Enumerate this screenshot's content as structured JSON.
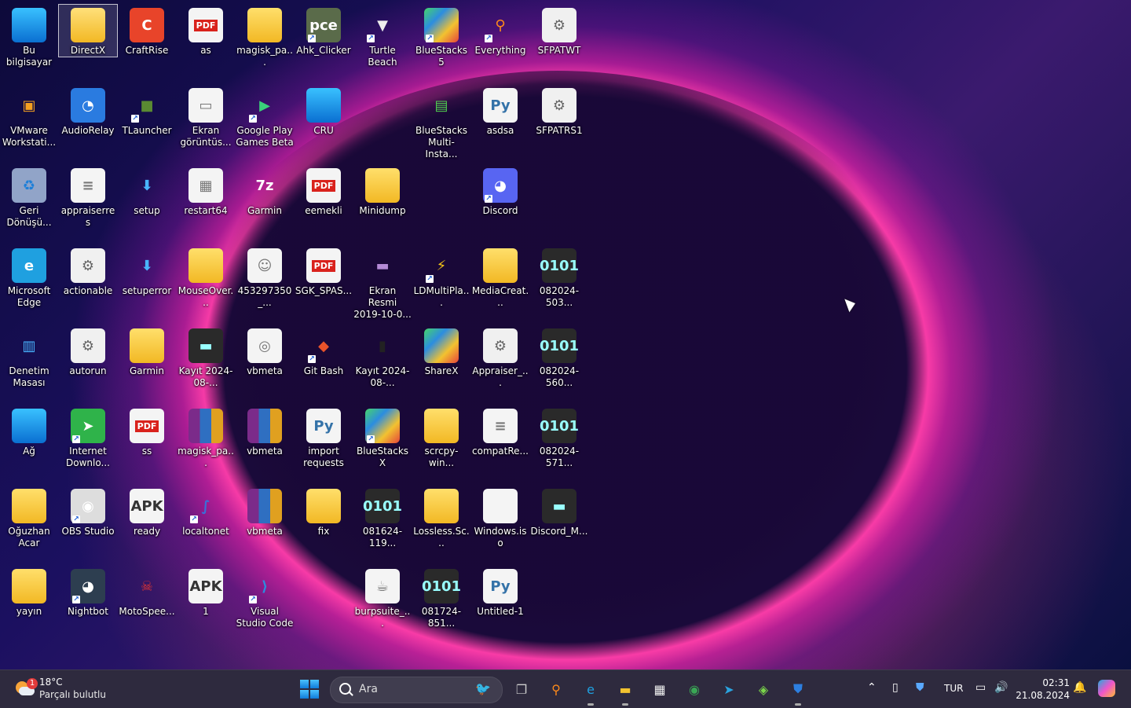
{
  "desktop_icons": [
    {
      "label": "Bu bilgisayar",
      "col": 0,
      "row": 0,
      "style": "k-monitor",
      "glyph": "",
      "shortcut": false,
      "selected": false
    },
    {
      "label": "DirectX",
      "col": 1,
      "row": 0,
      "style": "k-folder-red",
      "glyph": "",
      "shortcut": false,
      "selected": true
    },
    {
      "label": "CraftRise",
      "col": 2,
      "row": 0,
      "style": "k-round",
      "glyph": "C",
      "color": "#e8442a",
      "shortcut": false,
      "selected": false
    },
    {
      "label": "as",
      "col": 3,
      "row": 0,
      "style": "k-pdf",
      "glyph": "PDF",
      "shortcut": false,
      "selected": false
    },
    {
      "label": "magisk_pa...",
      "col": 4,
      "row": 0,
      "style": "k-folder",
      "glyph": "",
      "shortcut": false,
      "selected": false
    },
    {
      "label": "Ahk_Clicker",
      "col": 5,
      "row": 0,
      "style": "k-round",
      "glyph": "pce",
      "color": "#5a6b4a",
      "shortcut": true,
      "selected": false
    },
    {
      "label": "Turtle Beach",
      "col": 6,
      "row": 0,
      "style": "",
      "glyph": "▼",
      "color": "#eee",
      "shortcut": true,
      "selected": false
    },
    {
      "label": "BlueStacks 5",
      "col": 7,
      "row": 0,
      "style": "k-bluegreen",
      "glyph": "",
      "shortcut": true,
      "selected": false
    },
    {
      "label": "Everything",
      "col": 8,
      "row": 0,
      "style": "",
      "glyph": "⚲",
      "color": "#ff8a1a",
      "shortcut": true,
      "selected": false
    },
    {
      "label": "SFPATWT",
      "col": 9,
      "row": 0,
      "style": "k-gear",
      "glyph": "⚙",
      "shortcut": false,
      "selected": false
    },
    {
      "label": "VMware Workstati...",
      "col": 0,
      "row": 1,
      "style": "",
      "glyph": "▣",
      "color": "#f4a020",
      "shortcut": false,
      "selected": false
    },
    {
      "label": "AudioRelay",
      "col": 1,
      "row": 1,
      "style": "k-round",
      "glyph": "◔",
      "color": "#2a7be0",
      "shortcut": false,
      "selected": false
    },
    {
      "label": "TLauncher",
      "col": 2,
      "row": 1,
      "style": "",
      "glyph": "■",
      "color": "#5a8a32",
      "shortcut": true,
      "selected": false
    },
    {
      "label": "Ekran görüntüs...",
      "col": 3,
      "row": 1,
      "style": "k-file",
      "glyph": "▭",
      "shortcut": false,
      "selected": false
    },
    {
      "label": "Google Play Games Beta",
      "col": 4,
      "row": 1,
      "style": "",
      "glyph": "▶",
      "color": "#3ad07a",
      "shortcut": true,
      "selected": false
    },
    {
      "label": "CRU",
      "col": 5,
      "row": 1,
      "style": "k-monitor",
      "glyph": "",
      "shortcut": false,
      "selected": false
    },
    {
      "label": "BlueStacks Multi-Insta...",
      "col": 7,
      "row": 1,
      "style": "",
      "glyph": "▤",
      "color": "#4fd14f",
      "shortcut": false,
      "selected": false
    },
    {
      "label": "asdsa",
      "col": 8,
      "row": 1,
      "style": "k-py",
      "glyph": "Py",
      "shortcut": false,
      "selected": false
    },
    {
      "label": "SFPATRS1",
      "col": 9,
      "row": 1,
      "style": "k-gear",
      "glyph": "⚙",
      "shortcut": false,
      "selected": false
    },
    {
      "label": "Geri Dönüşü...",
      "col": 0,
      "row": 2,
      "style": "k-bin",
      "glyph": "♻",
      "shortcut": false,
      "selected": false
    },
    {
      "label": "appraiserres",
      "col": 1,
      "row": 2,
      "style": "k-file",
      "glyph": "≡",
      "shortcut": false,
      "selected": false
    },
    {
      "label": "setup",
      "col": 2,
      "row": 2,
      "style": "",
      "glyph": "⬇",
      "color": "#49b5ff",
      "shortcut": false,
      "selected": false
    },
    {
      "label": "restart64",
      "col": 3,
      "row": 2,
      "style": "k-file",
      "glyph": "▦",
      "shortcut": false,
      "selected": false
    },
    {
      "label": "Garmin",
      "col": 4,
      "row": 2,
      "style": "",
      "glyph": "7z",
      "color": "#fff",
      "shortcut": false,
      "selected": false
    },
    {
      "label": "eemekli",
      "col": 5,
      "row": 2,
      "style": "k-pdf",
      "glyph": "PDF",
      "shortcut": false,
      "selected": false
    },
    {
      "label": "Minidump",
      "col": 6,
      "row": 2,
      "style": "k-folder",
      "glyph": "",
      "shortcut": false,
      "selected": false
    },
    {
      "label": "Discord",
      "col": 8,
      "row": 2,
      "style": "k-round",
      "glyph": "◕",
      "color": "#5865f2",
      "shortcut": true,
      "selected": false
    },
    {
      "label": "Microsoft Edge",
      "col": 0,
      "row": 3,
      "style": "k-round",
      "glyph": "e",
      "color": "#1fa0e0",
      "shortcut": false,
      "selected": false
    },
    {
      "label": "actionable",
      "col": 1,
      "row": 3,
      "style": "k-gear",
      "glyph": "⚙",
      "shortcut": false,
      "selected": false
    },
    {
      "label": "setuperror",
      "col": 2,
      "row": 3,
      "style": "",
      "glyph": "⬇",
      "color": "#49b5ff",
      "shortcut": false,
      "selected": false
    },
    {
      "label": "MouseOver...",
      "col": 3,
      "row": 3,
      "style": "k-folder",
      "glyph": "",
      "shortcut": false,
      "selected": false
    },
    {
      "label": "453297350_...",
      "col": 4,
      "row": 3,
      "style": "k-file",
      "glyph": "☺",
      "shortcut": false,
      "selected": false
    },
    {
      "label": "SGK_SPAS...",
      "col": 5,
      "row": 3,
      "style": "k-pdf",
      "glyph": "PDF",
      "shortcut": false,
      "selected": false
    },
    {
      "label": "Ekran Resmi 2019-10-0...",
      "col": 6,
      "row": 3,
      "style": "",
      "glyph": "▬",
      "color": "#b48ad6",
      "shortcut": false,
      "selected": false
    },
    {
      "label": "LDMultiPla...",
      "col": 7,
      "row": 3,
      "style": "",
      "glyph": "⚡",
      "color": "#f5c518",
      "shortcut": true,
      "selected": false
    },
    {
      "label": "MediaCreat...",
      "col": 8,
      "row": 3,
      "style": "k-folder",
      "glyph": "",
      "shortcut": false,
      "selected": false
    },
    {
      "label": "082024-503...",
      "col": 9,
      "row": 3,
      "style": "k-dark",
      "glyph": "0101",
      "shortcut": false,
      "selected": false
    },
    {
      "label": "Denetim Masası",
      "col": 0,
      "row": 4,
      "style": "",
      "glyph": "▥",
      "color": "#49b5ff",
      "shortcut": false,
      "selected": false
    },
    {
      "label": "autorun",
      "col": 1,
      "row": 4,
      "style": "k-gear",
      "glyph": "⚙",
      "shortcut": false,
      "selected": false
    },
    {
      "label": "Garmin",
      "col": 2,
      "row": 4,
      "style": "k-folder",
      "glyph": "",
      "shortcut": false,
      "selected": false
    },
    {
      "label": "Kayıt 2024-08-...",
      "col": 3,
      "row": 4,
      "style": "k-dark",
      "glyph": "▬",
      "shortcut": false,
      "selected": false
    },
    {
      "label": "vbmeta",
      "col": 4,
      "row": 4,
      "style": "k-file",
      "glyph": "◎",
      "shortcut": false,
      "selected": false
    },
    {
      "label": "Git Bash",
      "col": 5,
      "row": 4,
      "style": "",
      "glyph": "◆",
      "color": "#e8532a",
      "shortcut": true,
      "selected": false
    },
    {
      "label": "Kayıt 2024-08-...",
      "col": 6,
      "row": 4,
      "style": "",
      "glyph": "▮",
      "color": "#222",
      "shortcut": false,
      "selected": false
    },
    {
      "label": "ShareX",
      "col": 7,
      "row": 4,
      "style": "k-round k-bluegreen",
      "glyph": "",
      "shortcut": false,
      "selected": false
    },
    {
      "label": "Appraiser_...",
      "col": 8,
      "row": 4,
      "style": "k-gear",
      "glyph": "⚙",
      "shortcut": false,
      "selected": false
    },
    {
      "label": "082024-560...",
      "col": 9,
      "row": 4,
      "style": "k-dark",
      "glyph": "0101",
      "shortcut": false,
      "selected": false
    },
    {
      "label": "Ağ",
      "col": 0,
      "row": 5,
      "style": "k-monitor",
      "glyph": "",
      "shortcut": false,
      "selected": false
    },
    {
      "label": "Internet Downlo...",
      "col": 1,
      "row": 5,
      "style": "k-round",
      "glyph": "➤",
      "color": "#2fb34a",
      "shortcut": true,
      "selected": false
    },
    {
      "label": "ss",
      "col": 2,
      "row": 5,
      "style": "k-pdf",
      "glyph": "PDF",
      "shortcut": false,
      "selected": false
    },
    {
      "label": "magisk_pa...",
      "col": 3,
      "row": 5,
      "style": "k-rar",
      "glyph": "",
      "shortcut": false,
      "selected": false
    },
    {
      "label": "vbmeta",
      "col": 4,
      "row": 5,
      "style": "k-rar",
      "glyph": "",
      "shortcut": false,
      "selected": false
    },
    {
      "label": "import requests",
      "col": 5,
      "row": 5,
      "style": "k-py",
      "glyph": "Py",
      "shortcut": false,
      "selected": false
    },
    {
      "label": "BlueStacks X",
      "col": 6,
      "row": 5,
      "style": "k-bluegreen",
      "glyph": "",
      "shortcut": true,
      "selected": false
    },
    {
      "label": "scrcpy-win...",
      "col": 7,
      "row": 5,
      "style": "k-folder",
      "glyph": "",
      "shortcut": false,
      "selected": false
    },
    {
      "label": "compatRe...",
      "col": 8,
      "row": 5,
      "style": "k-file",
      "glyph": "≡",
      "shortcut": false,
      "selected": false
    },
    {
      "label": "082024-571...",
      "col": 9,
      "row": 5,
      "style": "k-dark",
      "glyph": "0101",
      "shortcut": false,
      "selected": false
    },
    {
      "label": "Oğuzhan Acar",
      "col": 0,
      "row": 6,
      "style": "k-folder",
      "glyph": "",
      "shortcut": false,
      "selected": false
    },
    {
      "label": "OBS Studio",
      "col": 1,
      "row": 6,
      "style": "k-round",
      "glyph": "◉",
      "color": "#ddd",
      "shortcut": true,
      "selected": false
    },
    {
      "label": "ready",
      "col": 2,
      "row": 6,
      "style": "k-apk",
      "glyph": "APK",
      "shortcut": false,
      "selected": false
    },
    {
      "label": "localtonet",
      "col": 3,
      "row": 6,
      "style": "",
      "glyph": "∫",
      "color": "#3a6fd8",
      "shortcut": true,
      "selected": false
    },
    {
      "label": "vbmeta",
      "col": 4,
      "row": 6,
      "style": "k-rar",
      "glyph": "",
      "shortcut": false,
      "selected": false
    },
    {
      "label": "fix",
      "col": 5,
      "row": 6,
      "style": "k-folder",
      "glyph": "",
      "shortcut": false,
      "selected": false
    },
    {
      "label": "081624-119...",
      "col": 6,
      "row": 6,
      "style": "k-dark",
      "glyph": "0101",
      "shortcut": false,
      "selected": false
    },
    {
      "label": "Lossless.Sc...",
      "col": 7,
      "row": 6,
      "style": "k-folder",
      "glyph": "",
      "shortcut": false,
      "selected": false
    },
    {
      "label": "Windows.iso",
      "col": 8,
      "row": 6,
      "style": "k-file",
      "glyph": "",
      "shortcut": false,
      "selected": false
    },
    {
      "label": "Discord_M...",
      "col": 9,
      "row": 6,
      "style": "k-dark",
      "glyph": "▬",
      "shortcut": false,
      "selected": false
    },
    {
      "label": "yayın",
      "col": 0,
      "row": 7,
      "style": "k-folder",
      "glyph": "",
      "shortcut": false,
      "selected": false
    },
    {
      "label": "Nightbot",
      "col": 1,
      "row": 7,
      "style": "k-round",
      "glyph": "◕",
      "color": "#2d3e50",
      "shortcut": true,
      "selected": false
    },
    {
      "label": "MotoSpee...",
      "col": 2,
      "row": 7,
      "style": "",
      "glyph": "☠",
      "color": "#d33",
      "shortcut": false,
      "selected": false
    },
    {
      "label": "1",
      "col": 3,
      "row": 7,
      "style": "k-apk",
      "glyph": "APK",
      "shortcut": false,
      "selected": false
    },
    {
      "label": "Visual Studio Code",
      "col": 4,
      "row": 7,
      "style": "",
      "glyph": "⟩",
      "color": "#2b8be0",
      "shortcut": true,
      "selected": false
    },
    {
      "label": "burpsuite_...",
      "col": 6,
      "row": 7,
      "style": "k-file",
      "glyph": "☕",
      "shortcut": false,
      "selected": false
    },
    {
      "label": "081724-851...",
      "col": 7,
      "row": 7,
      "style": "k-dark",
      "glyph": "0101",
      "shortcut": false,
      "selected": false
    },
    {
      "label": "Untitled-1",
      "col": 8,
      "row": 7,
      "style": "k-py",
      "glyph": "Py",
      "shortcut": false,
      "selected": false
    }
  ],
  "taskbar": {
    "weather": {
      "temp": "18°C",
      "condition": "Parçalı bulutlu",
      "badge": "1"
    },
    "search_placeholder": "Ara",
    "apps": [
      {
        "name": "task-view",
        "glyph": "❐",
        "color": "#ccc",
        "running": false
      },
      {
        "name": "everything",
        "glyph": "⚲",
        "color": "#ff8a1a",
        "running": false
      },
      {
        "name": "edge",
        "glyph": "e",
        "color": "#1fa0e0",
        "running": true
      },
      {
        "name": "file-explorer",
        "glyph": "▬",
        "color": "#f2c230",
        "running": true
      },
      {
        "name": "microsoft-store",
        "glyph": "▦",
        "color": "#f0f0f0",
        "running": false
      },
      {
        "name": "chrome",
        "glyph": "◉",
        "color": "#3aa655",
        "running": false
      },
      {
        "name": "telegram",
        "glyph": "➤",
        "color": "#2aa3df",
        "running": false
      },
      {
        "name": "bluestacks",
        "glyph": "◈",
        "color": "#7bd64a",
        "running": false
      },
      {
        "name": "defender",
        "glyph": "⛊",
        "color": "#2d7fe0",
        "running": true
      }
    ],
    "tray": {
      "language": "TUR",
      "time": "02:31",
      "date": "21.08.2024"
    }
  }
}
